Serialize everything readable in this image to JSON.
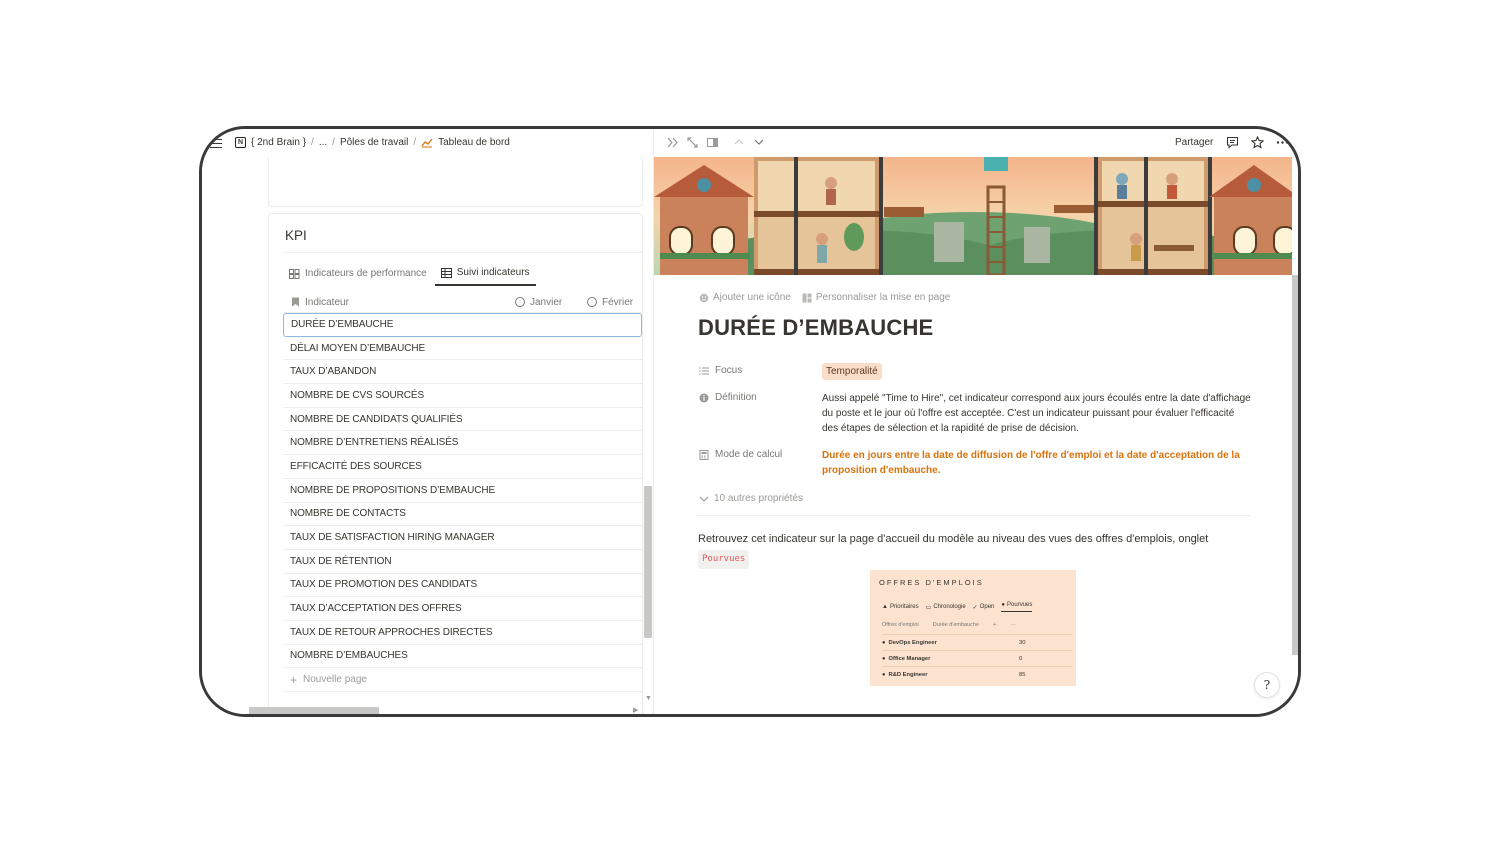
{
  "breadcrumb": {
    "items": [
      "{ 2nd Brain }",
      "...",
      "Pôles de travail",
      "Tableau de bord"
    ],
    "separator": "/"
  },
  "kpi": {
    "title": "KPI",
    "tabs": [
      {
        "label": "Indicateurs de performance",
        "icon": "gallery-icon",
        "active": false
      },
      {
        "label": "Suivi indicateurs",
        "icon": "table-icon",
        "active": true
      }
    ],
    "columns": {
      "indicator": "Indicateur",
      "january": "Janvier",
      "february": "Février"
    },
    "rows": [
      "DURÉE D’EMBAUCHE",
      "DÉLAI MOYEN D’EMBAUCHE",
      "TAUX D’ABANDON",
      "NOMBRE DE CVS SOURCÉS",
      "NOMBRE DE CANDIDATS QUALIFIÉS",
      "NOMBRE D’ENTRETIENS RÉALISÉS",
      "EFFICACITÉ DES SOURCES",
      "NOMBRE DE PROPOSITIONS D’EMBAUCHE",
      "NOMBRE DE CONTACTS",
      "TAUX DE SATISFACTION HIRING MANAGER",
      "TAUX DE RÉTENTION",
      "TAUX DE PROMOTION DES CANDIDATS",
      "TAUX D’ACCEPTATION DES OFFRES",
      "TAUX DE RETOUR APPROCHES DIRECTES",
      "NOMBRE D’EMBAUCHES"
    ],
    "selected_row": 0,
    "new_row_label": "Nouvelle page"
  },
  "topbar": {
    "share_label": "Partager"
  },
  "page": {
    "add_icon_label": "Ajouter une icône",
    "customize_label": "Personnaliser la mise en page",
    "title": "DURÉE D’EMBAUCHE",
    "properties": {
      "focus": {
        "label": "Focus",
        "value": "Temporalité"
      },
      "definition": {
        "label": "Définition",
        "value": "Aussi appelé \"Time to Hire\", cet indicateur correspond aux jours écoulés entre la date d'affichage du poste et le jour où l'offre est acceptée. C'est un indicateur puissant pour évaluer l'efficacité des étapes de sélection et la rapidité de prise de décision."
      },
      "calc": {
        "label": "Mode de calcul",
        "value": "Durée en jours entre la date de diffusion de l'offre d'emploi et la date d'acceptation de la proposition d'embauche."
      }
    },
    "more_properties": "10 autres propriétés",
    "body_text": "Retrouvez cet indicateur sur la page d'accueil du modèle au niveau des vues des offres d'emplois, onglet",
    "body_code": "Pourvues"
  },
  "embed": {
    "title": "OFFRES D'EMPLOIS",
    "tabs": [
      "Prioritaires",
      "Chronologie",
      "Open",
      "Pourvues"
    ],
    "active_tab": 3,
    "headers": [
      "Offres d'emploi",
      "Durée d'embauche",
      "+",
      "···"
    ],
    "rows": [
      {
        "name": "DevOps Engineer",
        "value": "30"
      },
      {
        "name": "Office Manager",
        "value": "0"
      },
      {
        "name": "R&D Engineer",
        "value": "85"
      }
    ]
  },
  "colors": {
    "accent_orange": "#d9730d",
    "tag_bg": "#fadec9",
    "selection_border": "#90b8e1",
    "embed_bg": "#fbe3cf"
  }
}
